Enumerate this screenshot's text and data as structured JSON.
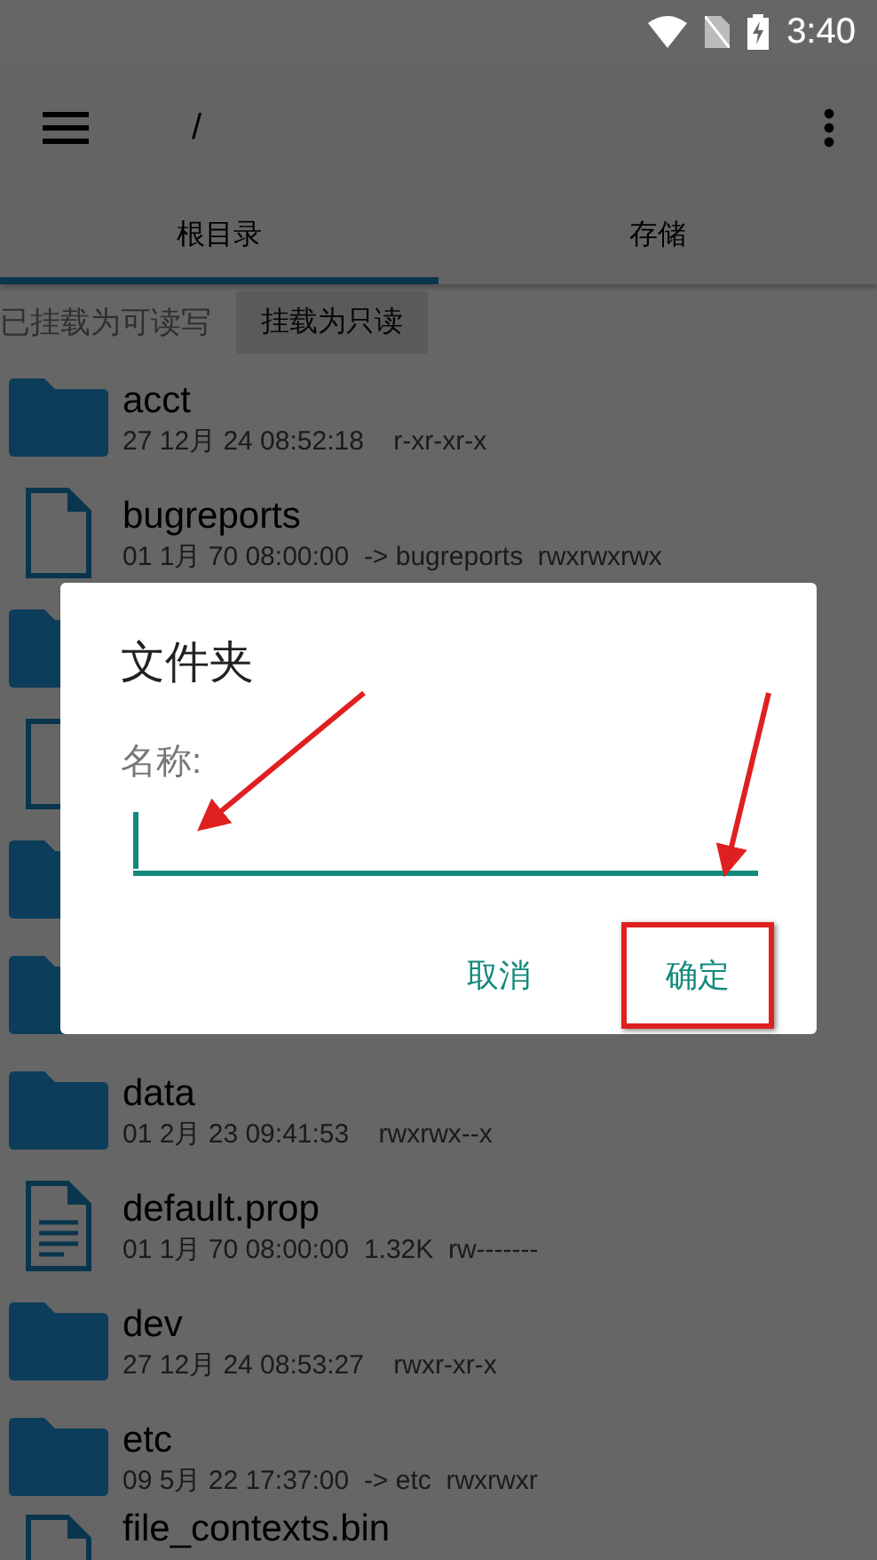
{
  "status_bar": {
    "time": "3:40"
  },
  "toolbar": {
    "path": "/"
  },
  "tabs": [
    {
      "label": "根目录",
      "selected": true
    },
    {
      "label": "存储",
      "selected": false
    }
  ],
  "mount": {
    "status": "已挂载为可读写",
    "button": "挂载为只读"
  },
  "files": [
    {
      "kind": "folder",
      "name": "acct",
      "meta": "27 12月 24 08:52:18    r-xr-xr-x"
    },
    {
      "kind": "link",
      "name": "bugreports",
      "meta": "01 1月 70 08:00:00  -> bugreports  rwxrwxrwx"
    },
    {
      "kind": "folder"
    },
    {
      "kind": "link"
    },
    {
      "kind": "folder"
    },
    {
      "kind": "folder"
    },
    {
      "kind": "folder",
      "name": "data",
      "meta": "01 2月 23 09:41:53    rwxrwx--x"
    },
    {
      "kind": "text",
      "name": "default.prop",
      "meta": "01 1月 70 08:00:00  1.32K  rw-------"
    },
    {
      "kind": "folder",
      "name": "dev",
      "meta": "27 12月 24 08:53:27    rwxr-xr-x"
    },
    {
      "kind": "folder",
      "name": "etc",
      "meta": "09 5月 22 17:37:00  -> etc  rwxrwxr"
    },
    {
      "kind": "link",
      "name": "file_contexts.bin"
    }
  ],
  "dialog": {
    "title": "文件夹",
    "label": "名称:",
    "buttons": [
      {
        "label": "取消",
        "highlighted": false
      },
      {
        "label": "确定",
        "highlighted": true
      }
    ]
  }
}
